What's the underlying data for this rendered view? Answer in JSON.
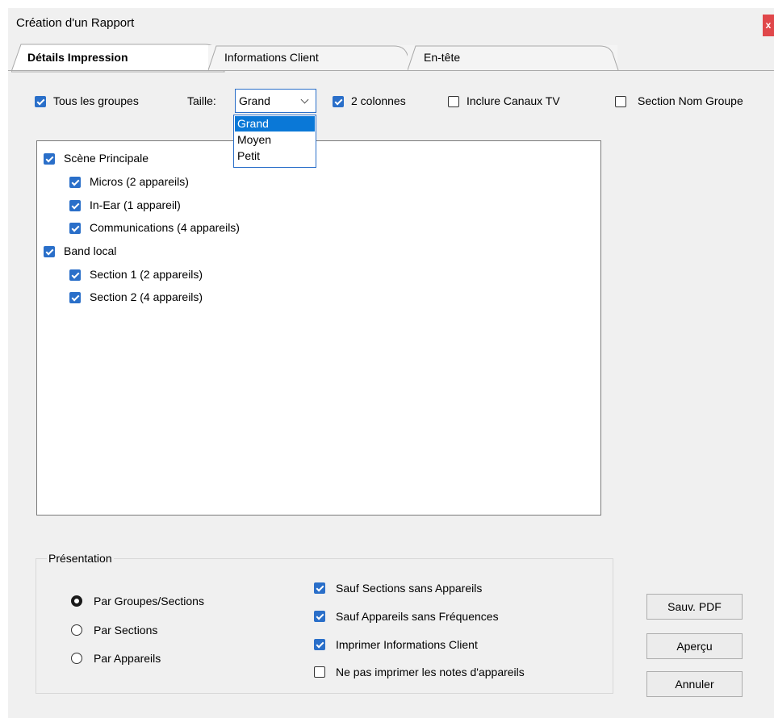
{
  "window": {
    "title": "Création d'un Rapport",
    "close_label": "x"
  },
  "tabs": [
    {
      "label": "Détails Impression"
    },
    {
      "label": "Informations Client"
    },
    {
      "label": "En-tête"
    }
  ],
  "options": {
    "all_groups": {
      "label": "Tous les groupes",
      "checked": true
    },
    "size_label": "Taille:",
    "size_value": "Grand",
    "size_options": [
      "Grand",
      "Moyen",
      "Petit"
    ],
    "two_columns": {
      "label": "2 colonnes",
      "checked": true
    },
    "include_tv": {
      "label": "Inclure Canaux TV",
      "checked": false
    },
    "group_name_section": {
      "label": "Section Nom Groupe",
      "checked": false
    }
  },
  "tree": [
    {
      "label": "Scène Principale",
      "checked": true,
      "level": 0
    },
    {
      "label": "Micros  (2 appareils)",
      "checked": true,
      "level": 1
    },
    {
      "label": "In-Ear  (1 appareil)",
      "checked": true,
      "level": 1
    },
    {
      "label": "Communications  (4 appareils)",
      "checked": true,
      "level": 1
    },
    {
      "label": "Band local",
      "checked": true,
      "level": 0
    },
    {
      "label": "Section 1  (2 appareils)",
      "checked": true,
      "level": 1
    },
    {
      "label": "Section 2  (4 appareils)",
      "checked": true,
      "level": 1
    }
  ],
  "presentation": {
    "legend": "Présentation",
    "radios": [
      {
        "label": "Par Groupes/Sections",
        "selected": true
      },
      {
        "label": "Par Sections",
        "selected": false
      },
      {
        "label": "Par Appareils",
        "selected": false
      }
    ],
    "checks": [
      {
        "label": "Sauf Sections sans Appareils",
        "checked": true
      },
      {
        "label": "Sauf Appareils sans Fréquences",
        "checked": true
      },
      {
        "label": "Imprimer Informations Client",
        "checked": true
      },
      {
        "label": "Ne pas imprimer les notes d'appareils",
        "checked": false
      }
    ]
  },
  "buttons": {
    "save_pdf": "Sauv. PDF",
    "preview": "Aperçu",
    "cancel": "Annuler"
  },
  "colors": {
    "accent": "#2a6fc9",
    "selection": "#0a78d7",
    "close": "#e0474a"
  }
}
